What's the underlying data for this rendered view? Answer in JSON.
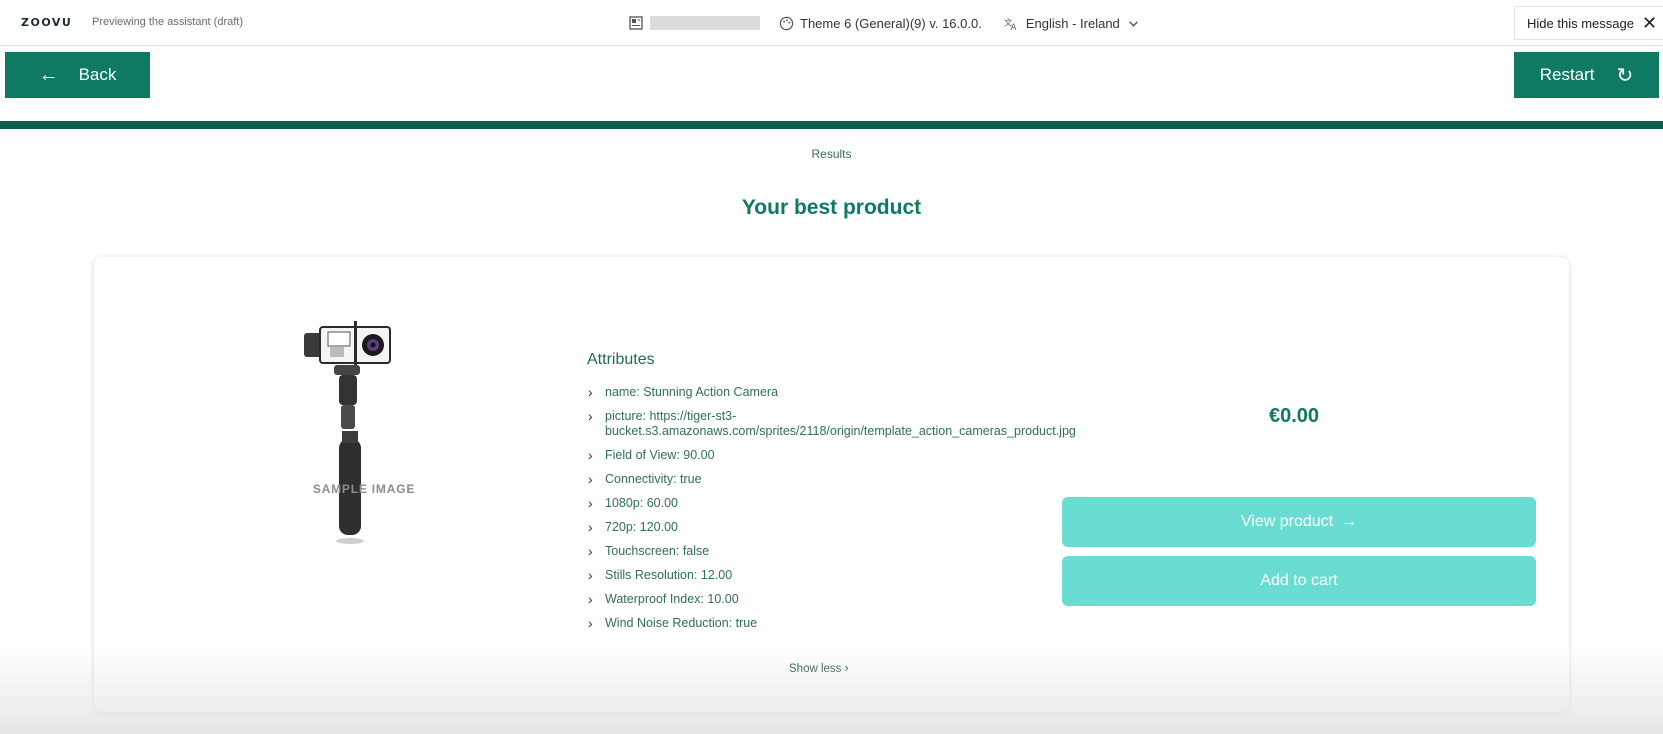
{
  "topbar": {
    "logo": "ZOOVU",
    "preview_text": "Previewing the assistant (draft)",
    "theme": "Theme 6 (General)(9) v. 16.0.0.",
    "language": "English - Ireland",
    "hide_label": "Hide this message"
  },
  "nav": {
    "back_label": "Back",
    "restart_label": "Restart"
  },
  "breadcrumb": "Results",
  "page_title": "Your best product",
  "product": {
    "image_label": "SAMPLE IMAGE",
    "attributes_title": "Attributes",
    "attributes": [
      "name: Stunning Action Camera",
      "picture: https://tiger-st3-bucket.s3.amazonaws.com/sprites/2118/origin/template_action_cameras_product.jpg",
      "Field of View: 90.00",
      "Connectivity: true",
      "1080p: 60.00",
      "720p: 120.00",
      "Touchscreen: false",
      "Stills Resolution: 12.00",
      "Waterproof Index: 10.00",
      "Wind Noise Reduction: true"
    ],
    "show_less": "Show less",
    "price": "€0.00",
    "view_label": "View product",
    "cart_label": "Add to cart"
  },
  "colors": {
    "primary": "#0e7a62",
    "divider": "#0b5c4e",
    "button_light": "#6addd2"
  }
}
